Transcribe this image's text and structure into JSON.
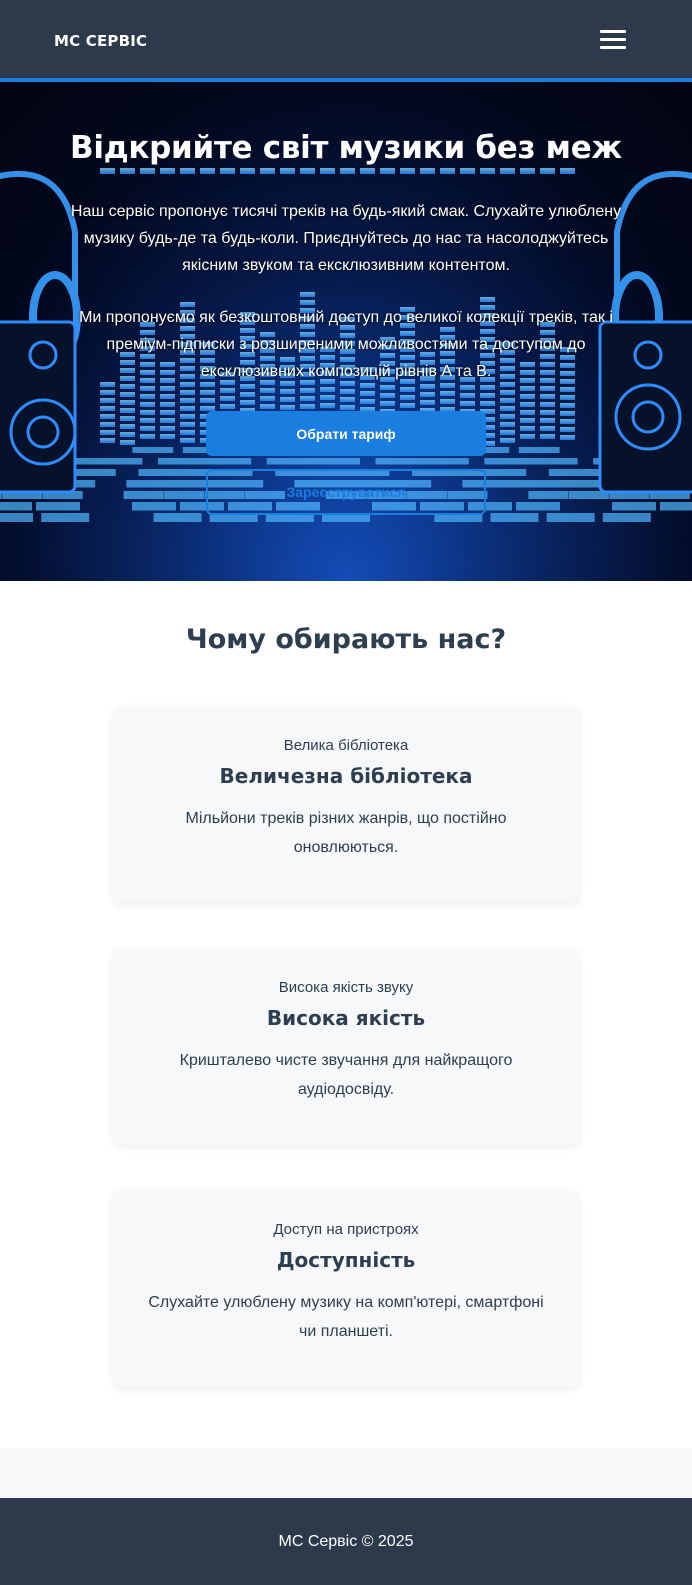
{
  "header": {
    "brand": "МС СЕРВІС",
    "menu_icon": "hamburger-menu-icon"
  },
  "hero": {
    "title": "Відкрийте світ музики без меж",
    "paragraph_1": "Наш сервіс пропонує тисячі треків на будь-який смак. Слухайте улюблену музику будь-де та будь-коли. Приєднуйтесь до нас та насолоджуйтесь якісним звуком та ексклюзивним контентом.",
    "paragraph_2": "Ми пропонуємо як безкоштовний доступ до великої колекції треків, так і преміум-підписки з розширеними можливостями та доступом до ексклюзивних композицій рівнів A та B.",
    "primary_button": "Обрати тариф",
    "secondary_button": "Зареєструватися",
    "background_image": "neon-music-equalizer-with-headphones-and-speakers"
  },
  "features": {
    "title": "Чому обирають нас?",
    "cards": [
      {
        "kicker": "Велика бібліотека",
        "title": "Величезна бібліотека",
        "text": "Мільйони треків різних жанрів, що постійно оновлюються."
      },
      {
        "kicker": "Висока якість звуку",
        "title": "Висока якість",
        "text": "Кришталево чисте звучання для найкращого аудіодосвіду."
      },
      {
        "kicker": "Доступ на пристроях",
        "title": "Доступність",
        "text": "Слухайте улюблену музику на комп'ютері, смартфоні чи планшеті."
      }
    ]
  },
  "footer": {
    "copyright": "МС Сервіс © 2025"
  },
  "colors": {
    "header_bg": "#2d3a4b",
    "accent": "#1a7de0",
    "text": "#2c3e50",
    "card_bg": "#f7f8fa"
  }
}
